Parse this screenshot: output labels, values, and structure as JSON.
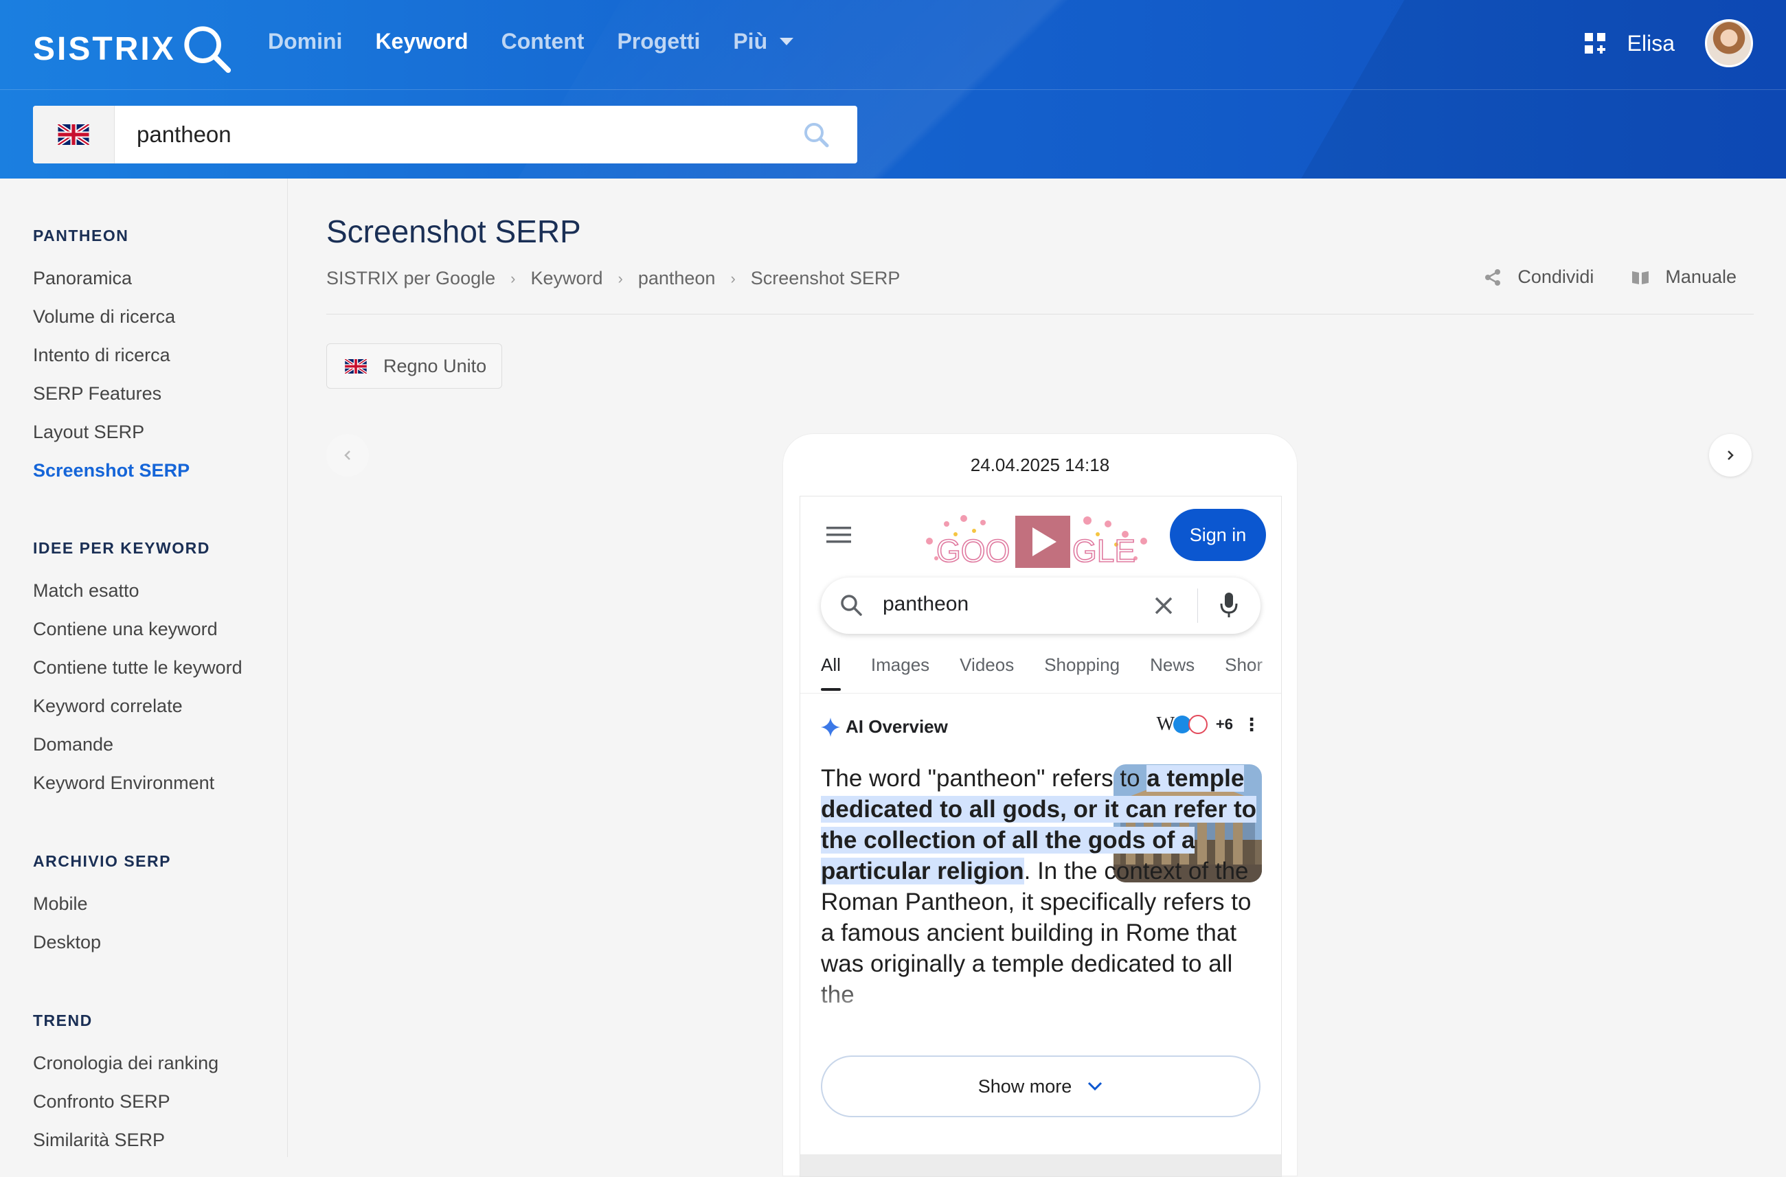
{
  "header": {
    "logo_text": "SISTRIX",
    "nav": [
      {
        "label": "Domini"
      },
      {
        "label": "Keyword"
      },
      {
        "label": "Content"
      },
      {
        "label": "Progetti"
      },
      {
        "label": "Più"
      }
    ],
    "user_name": "Elisa"
  },
  "search": {
    "query": "pantheon",
    "country_flag": "uk-flag-icon"
  },
  "sidebar": {
    "sections": [
      {
        "title": "PANTHEON",
        "items": [
          "Panoramica",
          "Volume di ricerca",
          "Intento di ricerca",
          "SERP Features",
          "Layout SERP",
          "Screenshot SERP"
        ]
      },
      {
        "title": "IDEE PER KEYWORD",
        "items": [
          "Match esatto",
          "Contiene una keyword",
          "Contiene tutte le keyword",
          "Keyword correlate",
          "Domande",
          "Keyword Environment"
        ]
      },
      {
        "title": "ARCHIVIO SERP",
        "items": [
          "Mobile",
          "Desktop"
        ]
      },
      {
        "title": "TREND",
        "items": [
          "Cronologia dei ranking",
          "Confronto SERP",
          "Similarità SERP"
        ]
      }
    ],
    "active_item": "Screenshot SERP"
  },
  "main": {
    "title": "Screenshot SERP",
    "breadcrumb": [
      "SISTRIX per Google",
      "Keyword",
      "pantheon",
      "Screenshot SERP"
    ],
    "tools": {
      "share": "Condividi",
      "manual": "Manuale"
    },
    "country_button": "Regno Unito"
  },
  "serp": {
    "timestamp": "24.04.2025 14:18",
    "sign_in": "Sign in",
    "query": "pantheon",
    "tabs": [
      "All",
      "Images",
      "Videos",
      "Shopping",
      "News",
      "Shor"
    ],
    "ai_overview_label": "AI Overview",
    "ai_sources_more": "+6",
    "ai_text_1": "The word \"pantheon\" refers to ",
    "ai_text_highlight": "a temple dedicated to all gods, or it can refer to the collection of all the gods of a particular religion",
    "ai_text_2": ". In the context of the Roman Pantheon, it specifically refers to a famous ancient building in Rome that was originally a temple dedicated to all the",
    "show_more": "Show more"
  },
  "colors": {
    "header_blue": "#1564cf",
    "accent_blue": "#1565d8",
    "google_button": "#0b57d0",
    "highlight": "#d3e3fd"
  }
}
